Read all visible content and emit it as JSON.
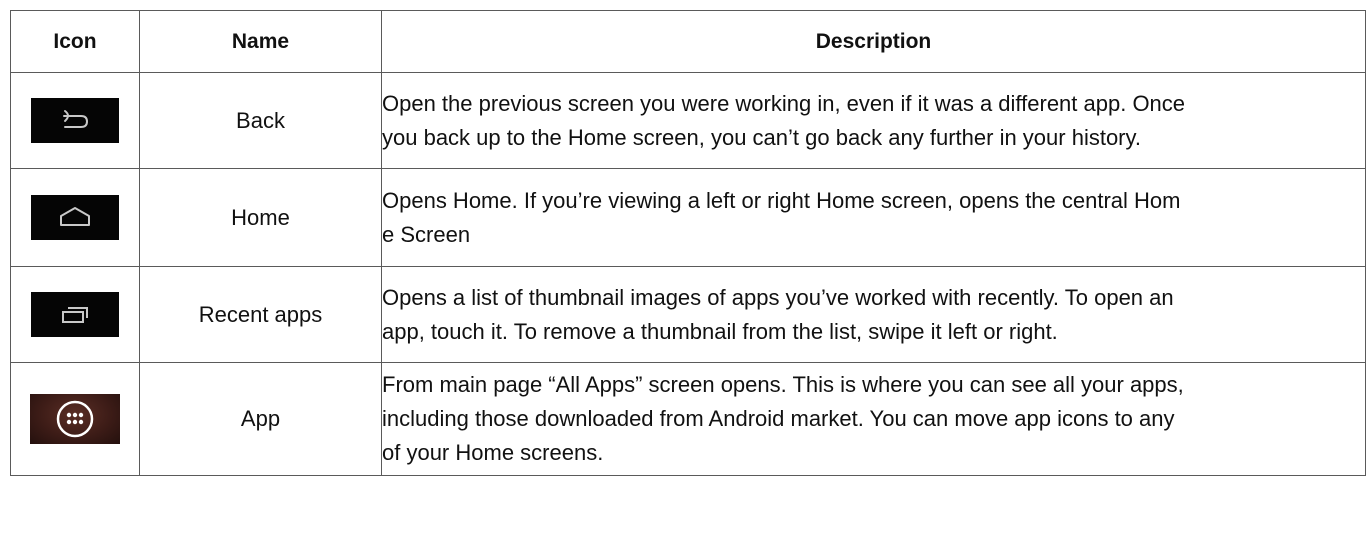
{
  "table": {
    "headers": {
      "icon": "Icon",
      "name": "Name",
      "description": "Description"
    },
    "rows": [
      {
        "icon": "back-arrow-icon",
        "name": "Back",
        "description_lines": [
          "Open the previous screen you were working in, even if it was a different app. Once",
          "you back up to the Home screen, you can’t go back any further in your history."
        ]
      },
      {
        "icon": "home-icon",
        "name": "Home",
        "description_lines": [
          "Opens Home. If you’re viewing a left or right Home screen, opens the central Hom",
          "e Screen"
        ]
      },
      {
        "icon": "recent-apps-icon",
        "name": "Recent apps",
        "description_lines": [
          "Opens a list of thumbnail images of apps you’ve worked with recently. To open an",
          "app, touch it. To remove a thumbnail from the list, swipe it left or right."
        ]
      },
      {
        "icon": "all-apps-icon",
        "name": "App",
        "description_lines": [
          "From main page “All Apps” screen opens. This is where you can see all your apps,",
          "including those downloaded from Android market. You can move app icons to any",
          "of your Home screens."
        ]
      }
    ]
  },
  "colors": {
    "icon_background": "#050505",
    "icon_stroke": "#c8c8c8",
    "app_icon_background": "#3d1c17",
    "border": "#5a5a5a"
  }
}
